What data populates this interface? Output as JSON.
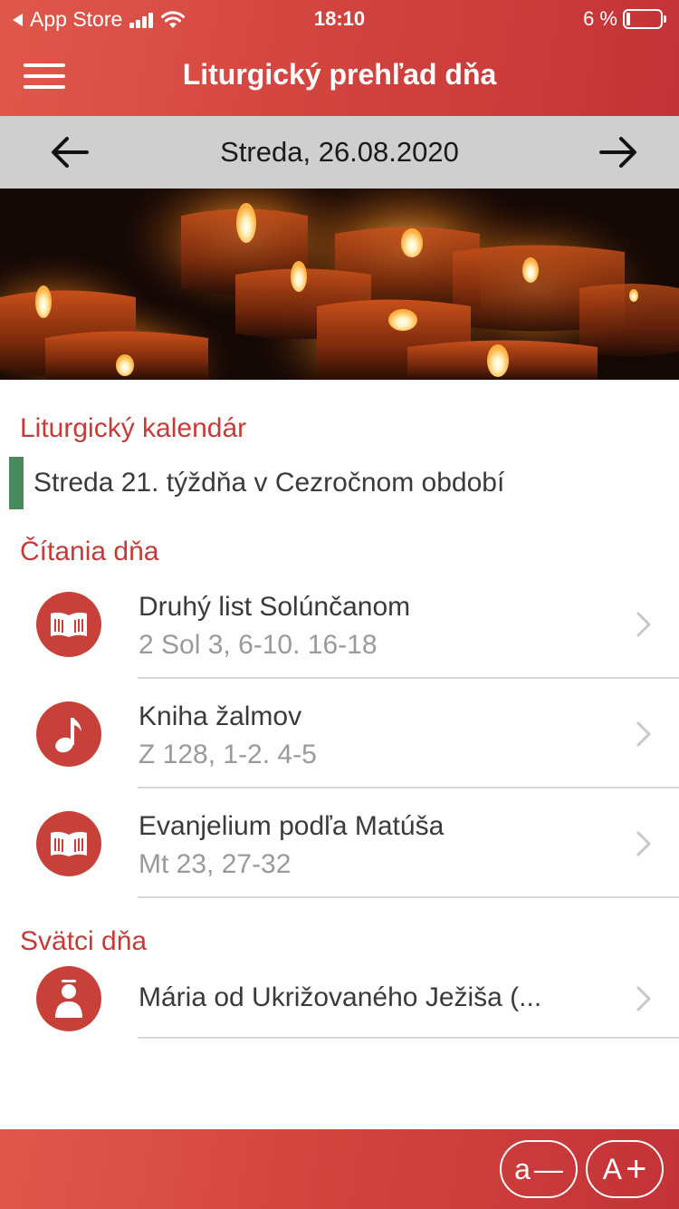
{
  "status_bar": {
    "back_app": "App Store",
    "time": "18:10",
    "battery": "6 %"
  },
  "header": {
    "title": "Liturgický prehľad dňa"
  },
  "date_nav": {
    "date": "Streda, 26.08.2020"
  },
  "calendar": {
    "heading": "Liturgický kalendár",
    "entry": "Streda 21. týždňa v Cezročnom období",
    "season_color": "#4a8a5a"
  },
  "readings": {
    "heading": "Čítania dňa",
    "items": [
      {
        "icon": "book-icon",
        "title": "Druhý list Solúnčanom",
        "ref": "2 Sol 3, 6-10. 16-18"
      },
      {
        "icon": "music-note-icon",
        "title": "Kniha žalmov",
        "ref": "Z 128, 1-2. 4-5"
      },
      {
        "icon": "book-icon",
        "title": "Evanjelium podľa Matúša",
        "ref": "Mt 23, 27-32"
      }
    ]
  },
  "saints": {
    "heading": "Svätci dňa",
    "items": [
      {
        "icon": "saint-person-icon",
        "title": "Mária od Ukrižovaného Ježiša (..."
      }
    ]
  },
  "font_controls": {
    "decrease_label": "a",
    "decrease_symbol": "—",
    "increase_label": "A",
    "increase_symbol": "+"
  },
  "colors": {
    "accent": "#d3453f",
    "section_title": "#c63a37",
    "date_bar": "#cfcfcf"
  }
}
